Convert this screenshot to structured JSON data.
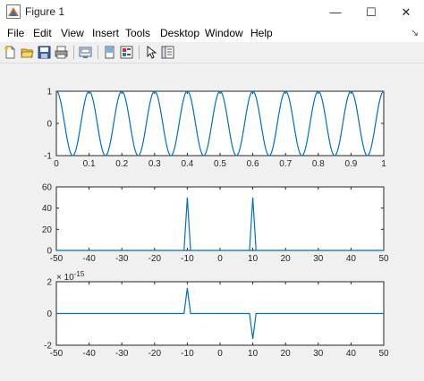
{
  "window": {
    "title": "Figure 1",
    "minimize": "—",
    "maximize": "☐",
    "close": "✕"
  },
  "menu": [
    "File",
    "Edit",
    "View",
    "Insert",
    "Tools",
    "Desktop",
    "Window",
    "Help"
  ],
  "menu_overflow": "↘",
  "toolbar": [
    "new-figure-icon",
    "open-file-icon",
    "save-icon",
    "print-icon",
    "print-preview-icon",
    "dock-icon",
    "insert-colorbar-icon",
    "pointer-icon",
    "property-inspector-icon"
  ],
  "colors": {
    "line": "#0072bd",
    "axes": "#262626",
    "background": "#ffffff",
    "figure": "#f0f0f0"
  },
  "chart_data": [
    {
      "type": "line",
      "x_range": [
        0,
        1
      ],
      "ylim": [
        -1,
        1
      ],
      "xticks": [
        "0",
        "0.1",
        "0.2",
        "0.3",
        "0.4",
        "0.5",
        "0.6",
        "0.7",
        "0.8",
        "0.9",
        "1"
      ],
      "yticks": [
        "-1",
        "0",
        "1"
      ],
      "function": "cos(2*pi*10*t)",
      "frequency": 10,
      "series": [
        {
          "values_description": "",
          "x": [
            0,
            1
          ]
        }
      ]
    },
    {
      "type": "line",
      "xlim": [
        -50,
        50
      ],
      "ylim": [
        0,
        60
      ],
      "xticks": [
        "-50",
        "-40",
        "-30",
        "-20",
        "-10",
        "0",
        "10",
        "20",
        "30",
        "40",
        "50"
      ],
      "yticks": [
        "0",
        "20",
        "40",
        "60"
      ],
      "series": [
        {
          "x": [
            -50,
            -11,
            -10,
            -9,
            9,
            10,
            11,
            50
          ],
          "y": [
            0,
            0,
            50,
            0,
            0,
            50,
            0,
            0
          ]
        }
      ]
    },
    {
      "type": "line",
      "xlim": [
        -50,
        50
      ],
      "ylim": [
        -2,
        2
      ],
      "exponent": "× 10^-15",
      "xticks": [
        "-50",
        "-40",
        "-30",
        "-20",
        "-10",
        "0",
        "10",
        "20",
        "30",
        "40",
        "50"
      ],
      "yticks": [
        "-2",
        "0",
        "2"
      ],
      "series": [
        {
          "x": [
            -50,
            -11,
            -10,
            -9,
            9,
            10,
            11,
            50
          ],
          "y": [
            0,
            0,
            1.6,
            0,
            0,
            -1.6,
            0,
            0
          ]
        }
      ]
    }
  ]
}
